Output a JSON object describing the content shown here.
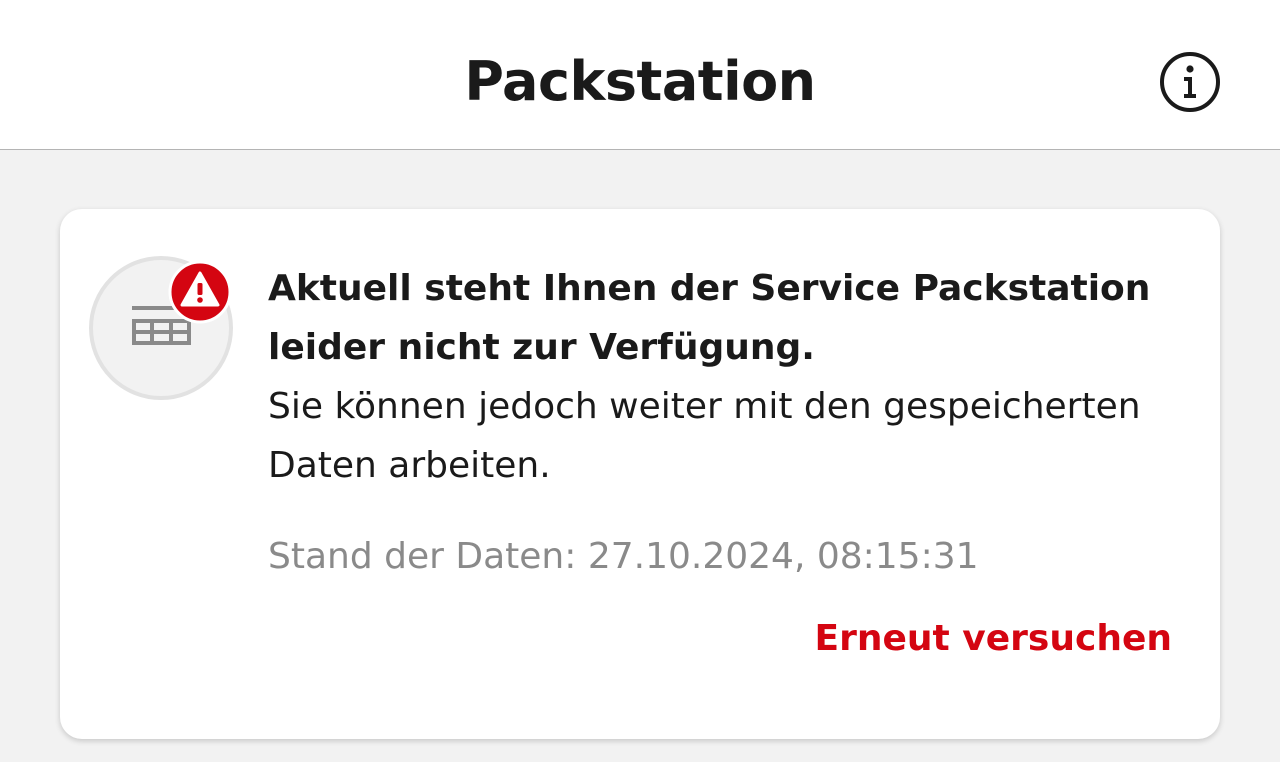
{
  "header": {
    "title": "Packstation",
    "info_icon": "info-circle-icon"
  },
  "card": {
    "status_icon": "packstation-locker-icon",
    "warning_badge_icon": "warning-triangle-icon",
    "title": "Aktuell steht Ihnen der Service Packstation leider nicht zur Verfügung.",
    "body": "Sie können jedoch weiter mit den gespeicherten Daten arbeiten.",
    "timestamp": "Stand der Daten: 27.10.2024, 08:15:31",
    "retry_label": "Erneut versuchen"
  },
  "colors": {
    "accent": "#d40511",
    "text": "#1a1a1a",
    "muted": "#8a8a8a",
    "background": "#f2f2f2"
  }
}
